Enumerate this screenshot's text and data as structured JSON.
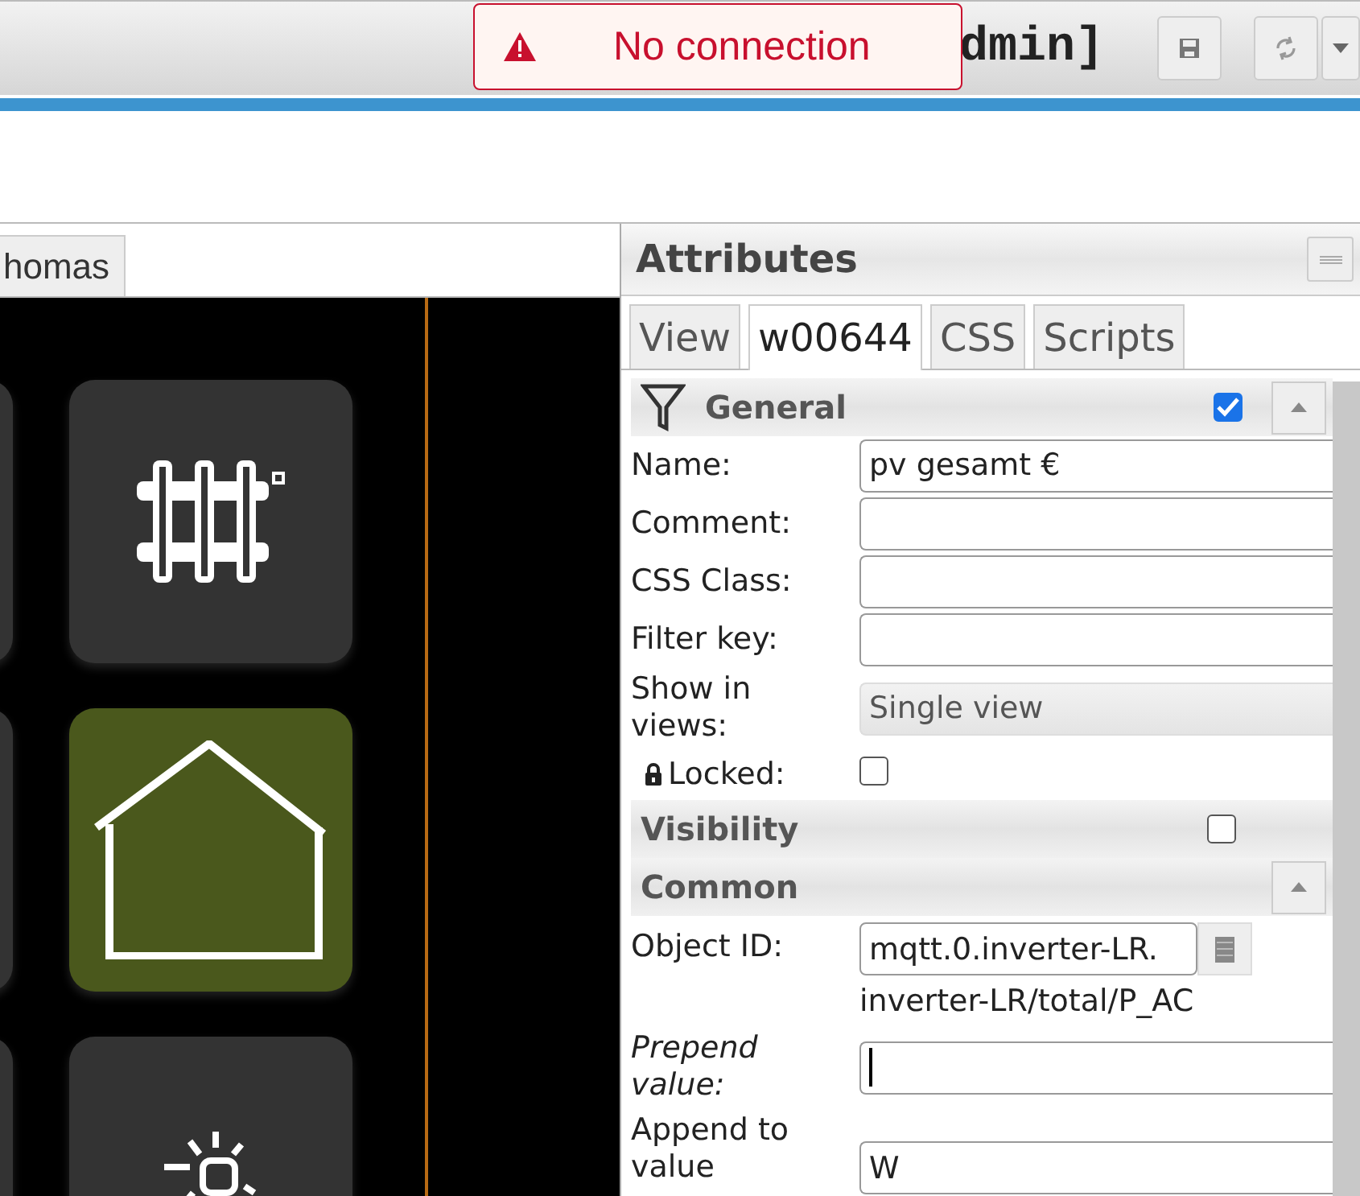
{
  "header": {
    "title": "dmin]",
    "toast": {
      "text": "No connection"
    }
  },
  "view_tabs": [
    {
      "label": "homas"
    }
  ],
  "canvas": {
    "tiles": [
      {
        "kind": "blank",
        "color": "#333333"
      },
      {
        "kind": "radiator",
        "color": "#333333"
      },
      {
        "kind": "blank",
        "color": "#333333"
      },
      {
        "kind": "house",
        "color": "#4a581c"
      },
      {
        "kind": "blank",
        "color": "#333333"
      },
      {
        "kind": "lamp",
        "color": "#333333"
      }
    ]
  },
  "attributes": {
    "title": "Attributes",
    "tabs": [
      {
        "label": "View",
        "selected": false
      },
      {
        "label": "w00644",
        "selected": true
      },
      {
        "label": "CSS",
        "selected": false
      },
      {
        "label": "Scripts",
        "selected": false
      }
    ],
    "sections": [
      {
        "title": "General",
        "filter": true,
        "checked": true,
        "collapsible": true,
        "rows": [
          {
            "kind": "text",
            "label": "Name:",
            "value": "pv gesamt €"
          },
          {
            "kind": "text",
            "label": "Comment:"
          },
          {
            "kind": "text",
            "label": "CSS Class:"
          },
          {
            "kind": "text",
            "label": "Filter key:"
          },
          {
            "kind": "select",
            "label": "Show in views:",
            "value": "Single view"
          },
          {
            "kind": "checkbox",
            "label": "Locked:",
            "checked": false
          }
        ]
      },
      {
        "title": "Visibility",
        "checked": false,
        "collapsible": false
      },
      {
        "title": "Common",
        "collapsible": true,
        "rows": [
          {
            "kind": "object",
            "label": "Object ID:",
            "value": "mqtt.0.inverter-LR.",
            "hint": "inverter-LR/total/P_AC"
          },
          {
            "kind": "text",
            "label": "Prepend value:",
            "italic": true,
            "focused": true
          },
          {
            "kind": "text",
            "label": "Append to value",
            "value": "W"
          }
        ]
      }
    ]
  }
}
